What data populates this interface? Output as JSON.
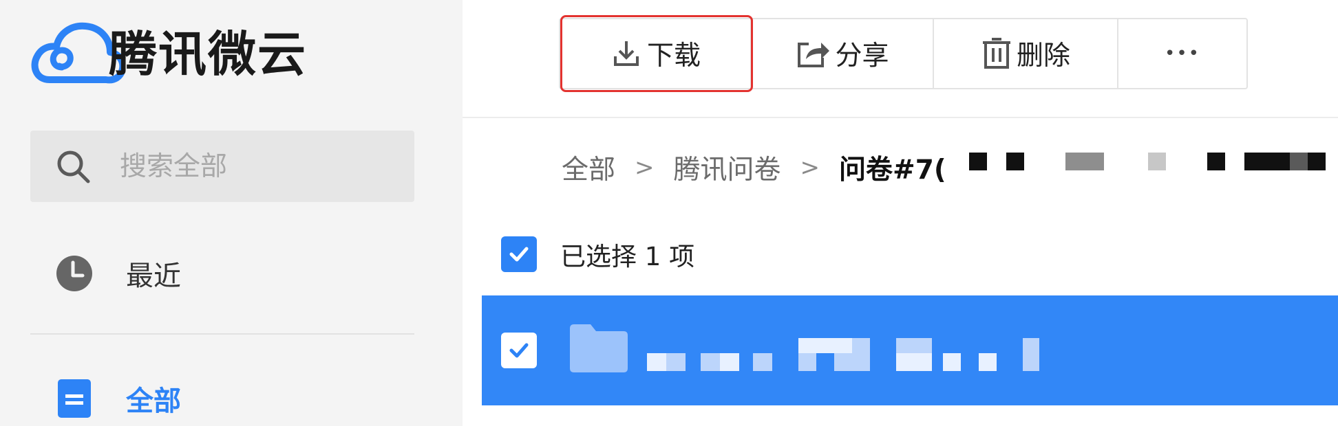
{
  "app": {
    "logo_text": "腾讯微云",
    "colors": {
      "accent": "#2d83f6",
      "selection_row": "#3287f7",
      "highlight": "#e3322f"
    }
  },
  "sidebar": {
    "search_placeholder": "搜索全部",
    "items": [
      {
        "label": "最近",
        "icon": "clock-icon",
        "active": false
      },
      {
        "label": "全部",
        "icon": "document-icon",
        "active": true
      }
    ]
  },
  "toolbar": {
    "download_label": "下载",
    "share_label": "分享",
    "delete_label": "删除",
    "more_label": "•••",
    "highlighted_button": "download"
  },
  "breadcrumb": {
    "items": [
      "全部",
      "腾讯问卷"
    ],
    "separator": ">",
    "current": "问卷#7("
  },
  "selection": {
    "checked": true,
    "text": "已选择 1 项"
  },
  "file_list": {
    "rows": [
      {
        "type": "folder",
        "icon": "folder-icon",
        "checked": true,
        "name_redacted": true
      }
    ]
  }
}
